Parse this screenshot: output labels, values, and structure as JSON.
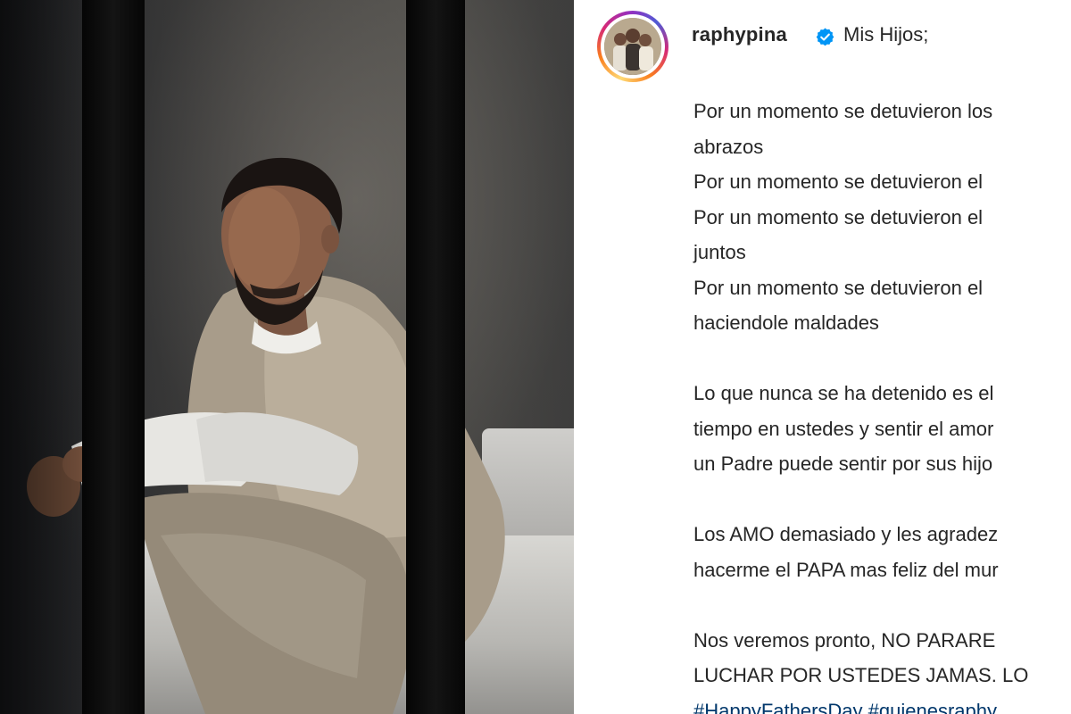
{
  "post": {
    "username": "raphypina",
    "first_line": "Mis Hijos;",
    "caption_lines": [
      "Por un momento se detuvieron los",
      "abrazos",
      "Por un momento se detuvieron el",
      "Por un momento se detuvieron el",
      "juntos",
      "Por un momento se detuvieron el",
      "haciendole maldades",
      "",
      "Lo que nunca se ha detenido es el",
      "tiempo en ustedes y sentir el amor",
      "un Padre puede sentir por sus hijo",
      "",
      "Los AMO demasiado y les agradez",
      "hacerme el PAPA mas feliz del mur",
      "",
      "Nos veremos pronto, NO PARARE",
      "LUCHAR POR USTEDES JAMAS. LO"
    ],
    "hashtags": [
      "#HappyFathersDay",
      "#quienesraphy"
    ]
  },
  "icons": {
    "verified": "verified-badge-icon",
    "verified_color": "#0095f6"
  },
  "colors": {
    "text": "#262626",
    "hashtag": "#00376b"
  }
}
